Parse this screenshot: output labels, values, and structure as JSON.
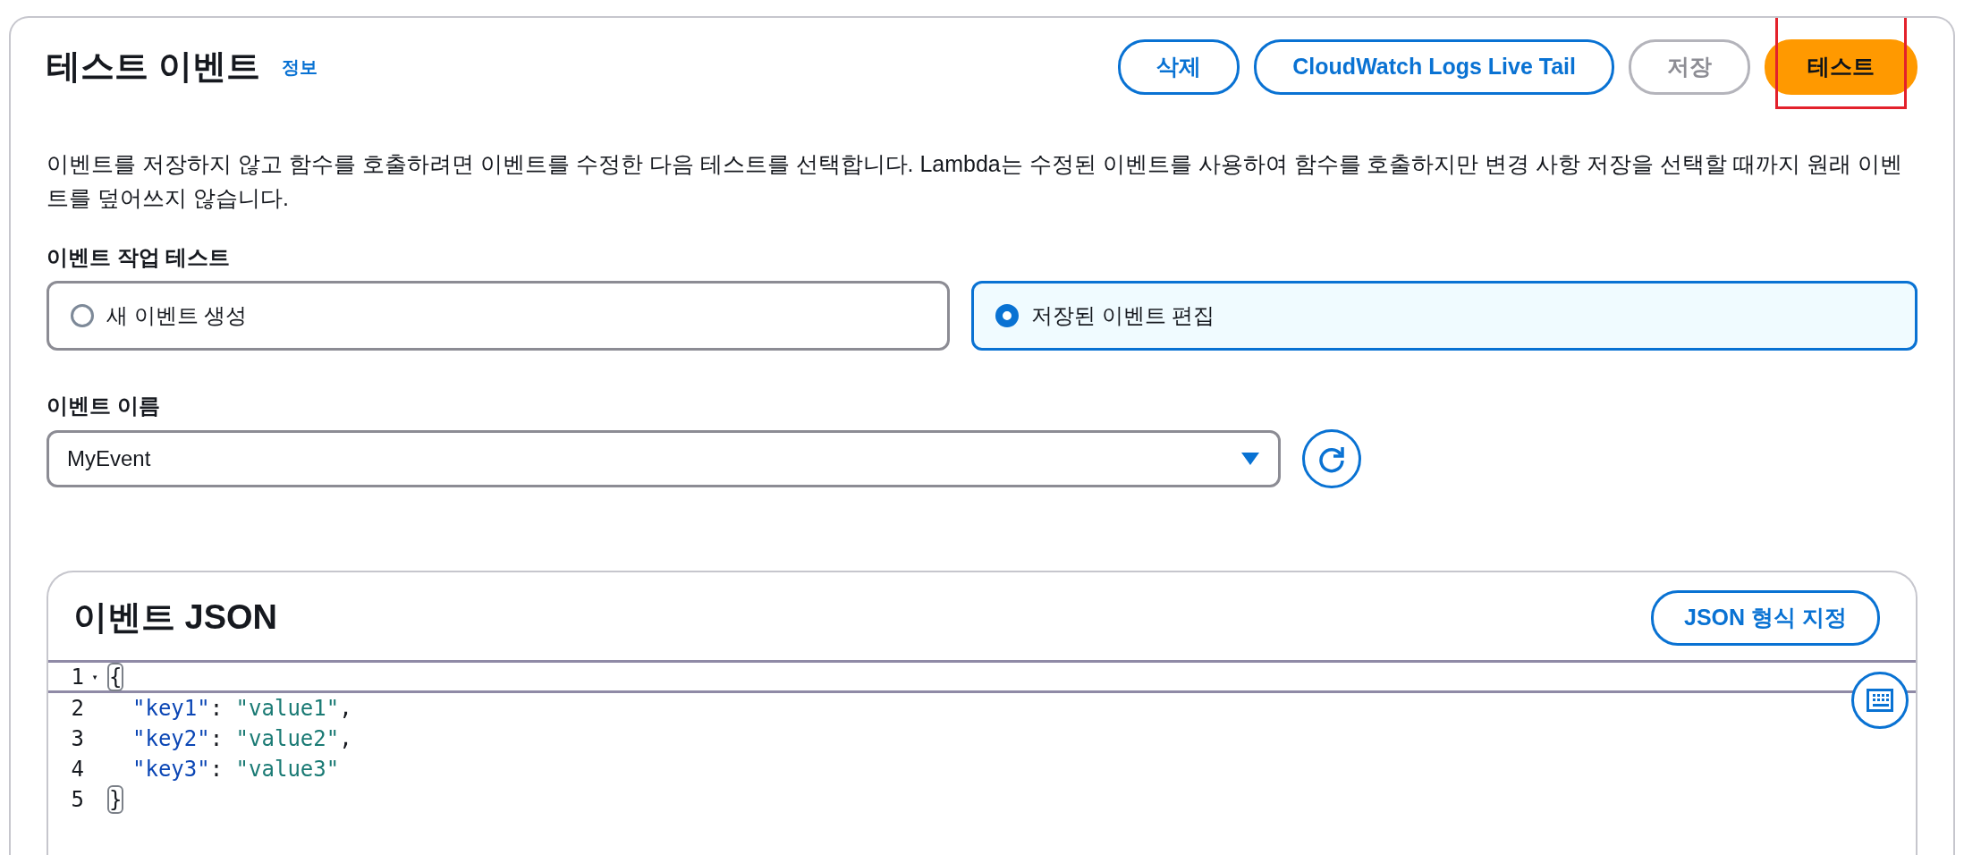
{
  "header": {
    "title": "테스트 이벤트",
    "info_link": "정보"
  },
  "actions": [
    {
      "label": "삭제",
      "kind": "normal",
      "disabled": false,
      "highlighted": false
    },
    {
      "label": "CloudWatch Logs Live Tail",
      "kind": "normal",
      "disabled": false,
      "highlighted": false
    },
    {
      "label": "저장",
      "kind": "normal",
      "disabled": true,
      "highlighted": false
    },
    {
      "label": "테스트",
      "kind": "primary",
      "disabled": false,
      "highlighted": true
    }
  ],
  "description": "이벤트를 저장하지 않고 함수를 호출하려면 이벤트를 수정한 다음 테스트를 선택합니다. Lambda는 수정된 이벤트를 사용하여 함수를 호출하지만 변경 사항 저장을 선택할 때까지 원래 이벤트를 덮어쓰지 않습니다.",
  "event_action": {
    "label": "이벤트 작업 테스트",
    "options": [
      {
        "label": "새 이벤트 생성",
        "selected": false
      },
      {
        "label": "저장된 이벤트 편집",
        "selected": true
      }
    ]
  },
  "event_name": {
    "label": "이벤트 이름",
    "value": "MyEvent"
  },
  "editor": {
    "title": "이벤트 JSON",
    "format_button": "JSON 형식 지정",
    "lines": [
      {
        "number": "1",
        "fold": "▾",
        "active": true,
        "tokens": [
          {
            "kind": "bracket",
            "text": "{",
            "matched": true
          }
        ]
      },
      {
        "number": "2",
        "active": false,
        "indented": true,
        "tokens": [
          {
            "kind": "key",
            "text": "\"key1\""
          },
          {
            "kind": "punct",
            "text": ": "
          },
          {
            "kind": "string",
            "text": "\"value1\""
          },
          {
            "kind": "punct",
            "text": ","
          }
        ]
      },
      {
        "number": "3",
        "active": false,
        "indented": true,
        "tokens": [
          {
            "kind": "key",
            "text": "\"key2\""
          },
          {
            "kind": "punct",
            "text": ": "
          },
          {
            "kind": "string",
            "text": "\"value2\""
          },
          {
            "kind": "punct",
            "text": ","
          }
        ]
      },
      {
        "number": "4",
        "active": false,
        "indented": true,
        "tokens": [
          {
            "kind": "key",
            "text": "\"key3\""
          },
          {
            "kind": "punct",
            "text": ": "
          },
          {
            "kind": "string",
            "text": "\"value3\""
          }
        ]
      },
      {
        "number": "5",
        "active": false,
        "tokens": [
          {
            "kind": "bracket",
            "text": "}",
            "matched": true
          }
        ]
      }
    ]
  }
}
